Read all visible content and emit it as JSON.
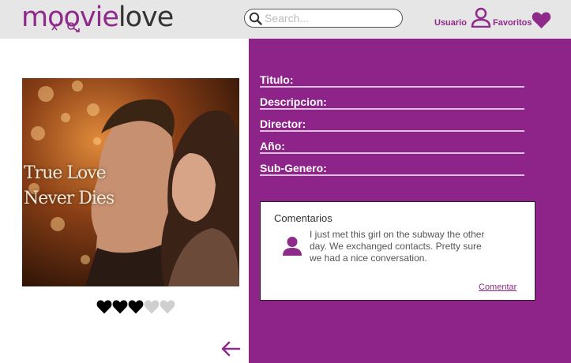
{
  "header": {
    "logo_part1": "moovie",
    "logo_part2": "love",
    "search_placeholder": "Search...",
    "user_label": "Usuario",
    "favorites_label": "Favoritos"
  },
  "movie": {
    "poster_title_line1": "True Love",
    "poster_title_line2": "Never Dies",
    "rating": {
      "value": 3,
      "max": 5
    }
  },
  "fields": [
    {
      "label": "Titulo:"
    },
    {
      "label": "Descripcion:"
    },
    {
      "label": "Director:"
    },
    {
      "label": "Año:"
    },
    {
      "label": "Sub-Genero:"
    }
  ],
  "comments": {
    "title": "Comentarios",
    "items": [
      {
        "text": "I just met this girl on the subway the other day. We exchanged contacts. Pretty sure we had a nice conversation."
      }
    ],
    "action_label": "Comentar"
  },
  "colors": {
    "brand_purple": "#8e2a8a",
    "panel_purple": "#8e248a",
    "header_gray": "#e6e6e6"
  },
  "icons": [
    "search-icon",
    "user-icon",
    "heart-icon",
    "arrow-left-icon",
    "avatar-icon"
  ]
}
